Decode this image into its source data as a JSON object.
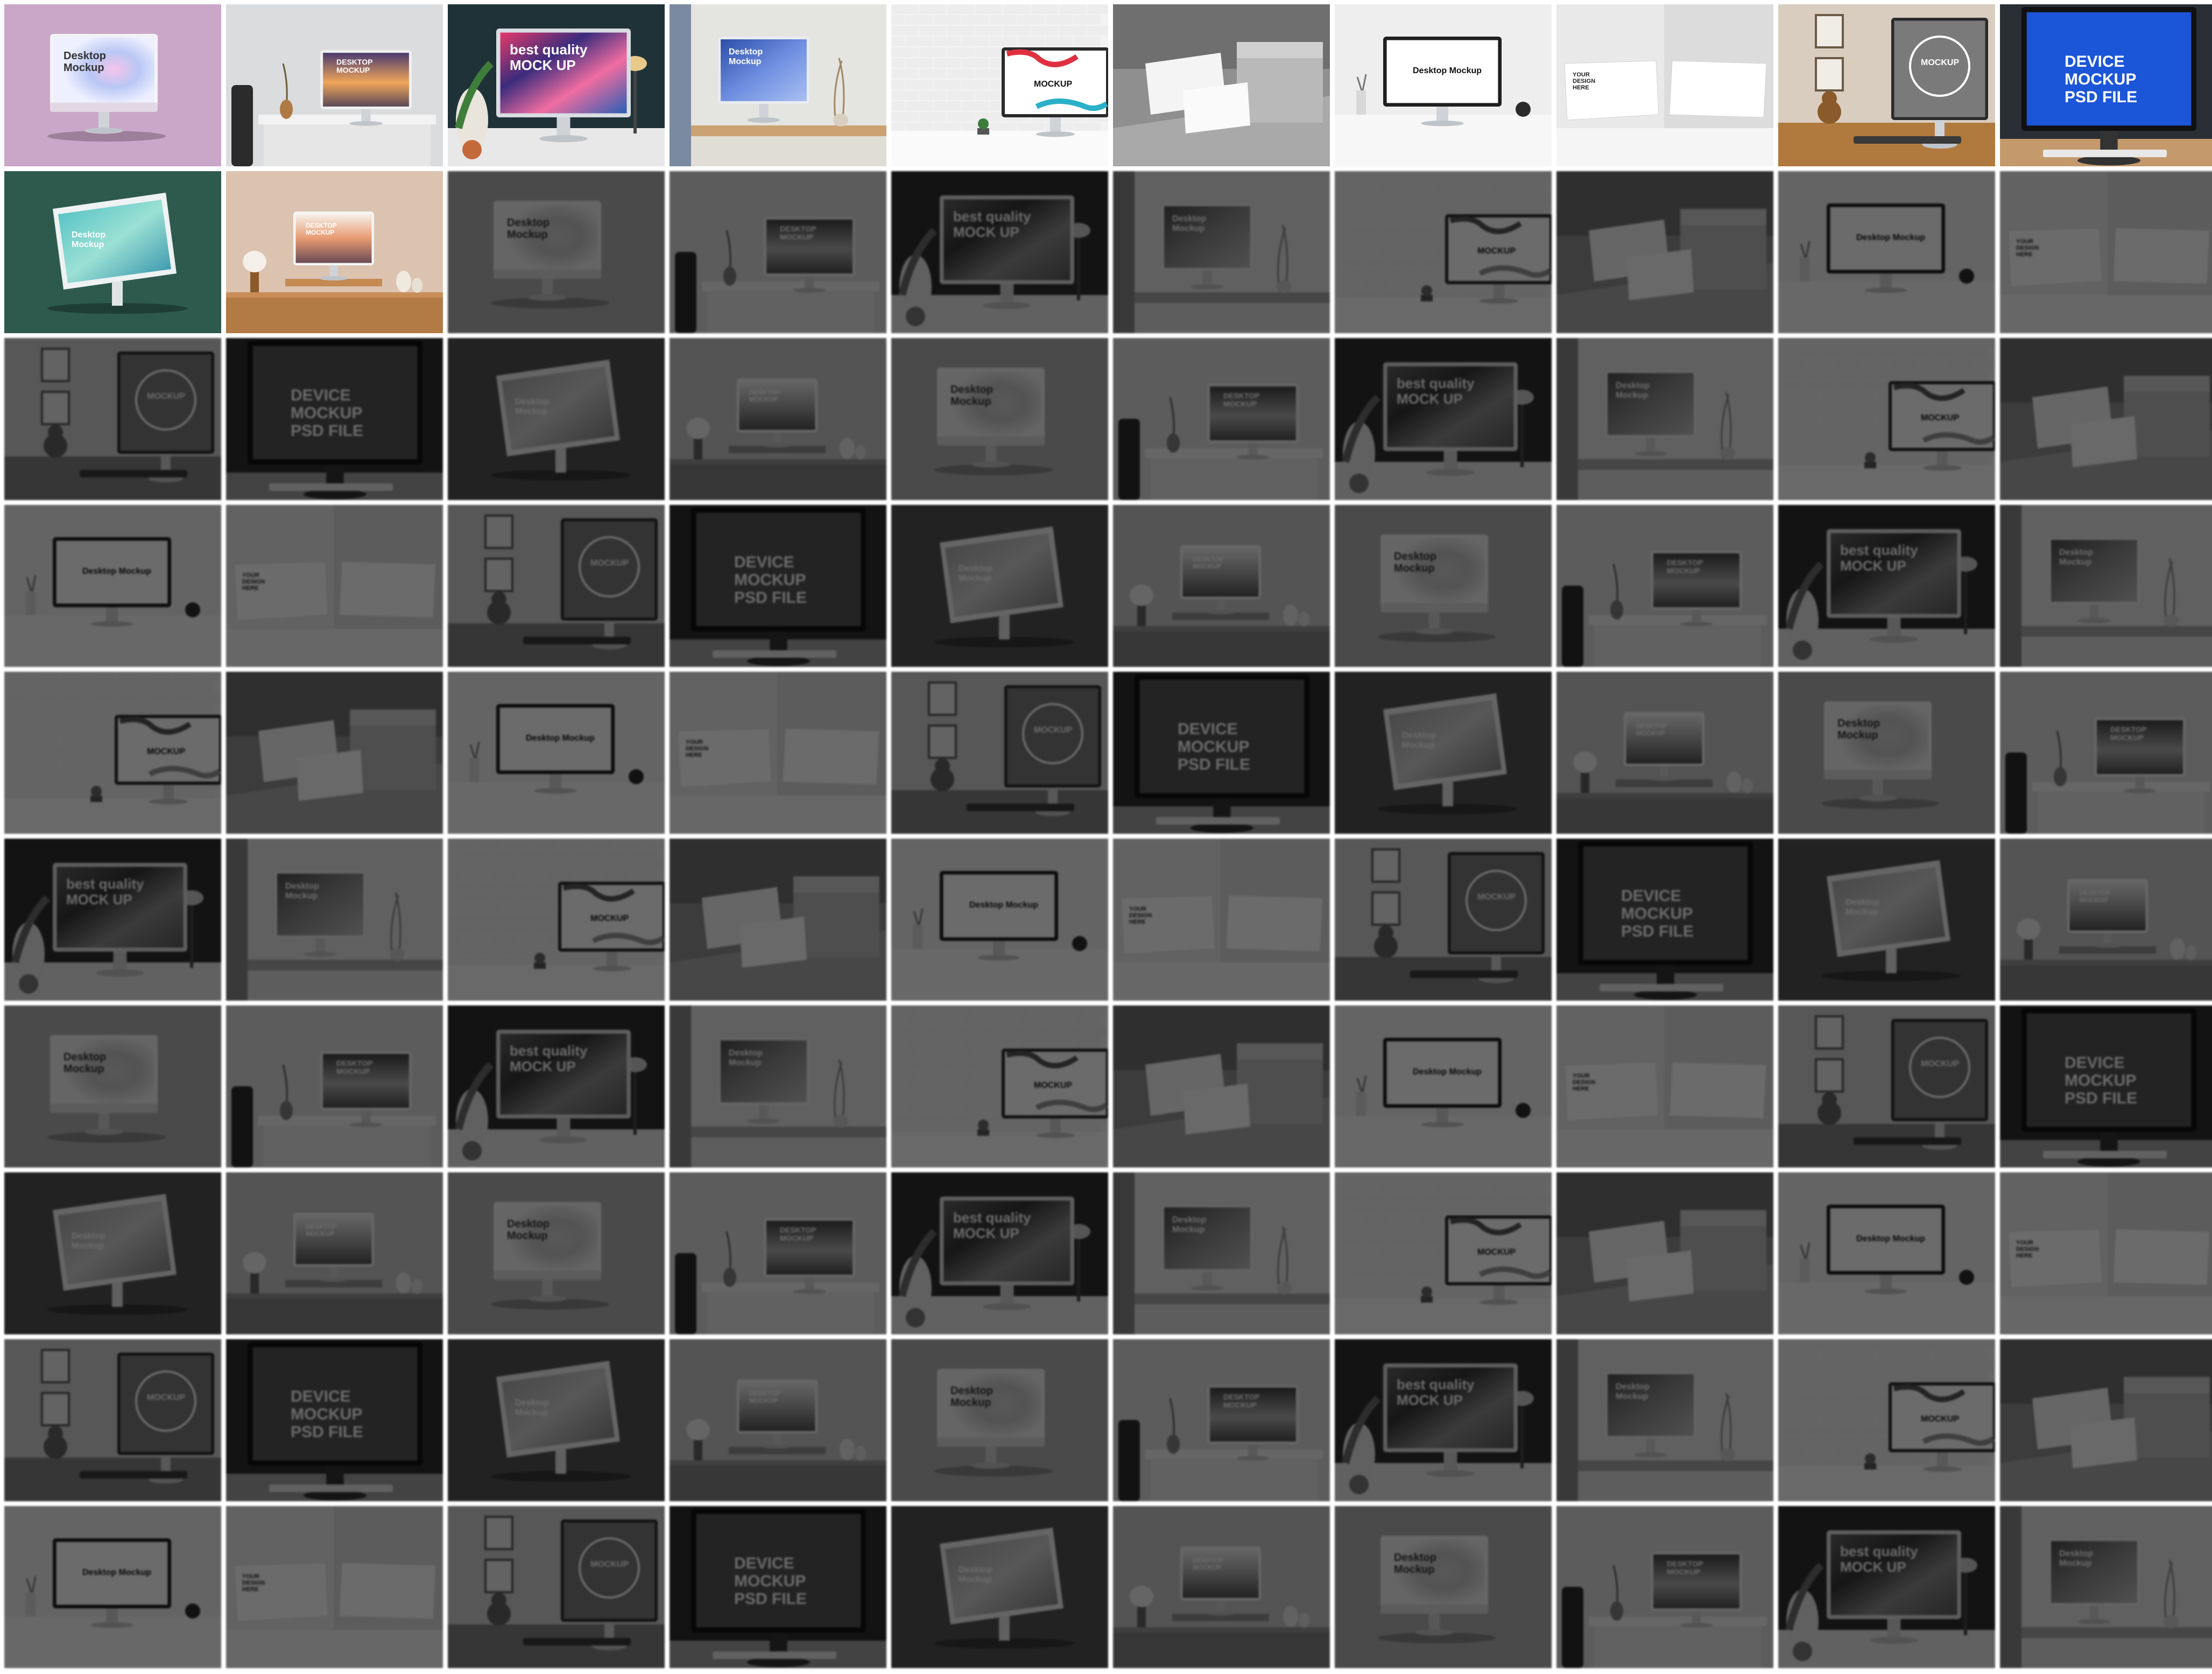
{
  "gallery": {
    "columns": 10,
    "rows": 10,
    "active_count": 12,
    "sequence": [
      {
        "id": "m1",
        "scene": "pink",
        "screen": "Desktop\nMockup"
      },
      {
        "id": "m2",
        "scene": "desk-sunset",
        "screen": "DESKTOP\nMOCKUP"
      },
      {
        "id": "m3",
        "scene": "dark-swirl",
        "screen": "best quality\nMOCK UP"
      },
      {
        "id": "m4",
        "scene": "desk-blue",
        "screen": "Desktop\nMockup"
      },
      {
        "id": "m5",
        "scene": "brick",
        "screen": "MOCKUP"
      },
      {
        "id": "m6",
        "scene": "concrete",
        "screen": ""
      },
      {
        "id": "m7",
        "scene": "white-desk",
        "screen": "Desktop Mockup"
      },
      {
        "id": "m8",
        "scene": "corner",
        "screen": "YOUR\nDESIGN\nHERE"
      },
      {
        "id": "m9",
        "scene": "shelf",
        "screen": "MOCKUP"
      },
      {
        "id": "m10",
        "scene": "blue",
        "screen": "DEVICE\nMOCKUP\nPSD FILE"
      },
      {
        "id": "m11",
        "scene": "green",
        "screen": "Desktop\nMockup"
      },
      {
        "id": "m12",
        "scene": "beige",
        "screen": "DESKTOP\nMOCKUP"
      }
    ]
  },
  "colors": {
    "page_background": "#ffffff",
    "pink_bg": "#caa7c8",
    "green_bg": "#2e5a4e",
    "beige_bg": "#dcc3b0",
    "blue_screen": "#1c56d8",
    "dark_bg": "#1f3238"
  }
}
